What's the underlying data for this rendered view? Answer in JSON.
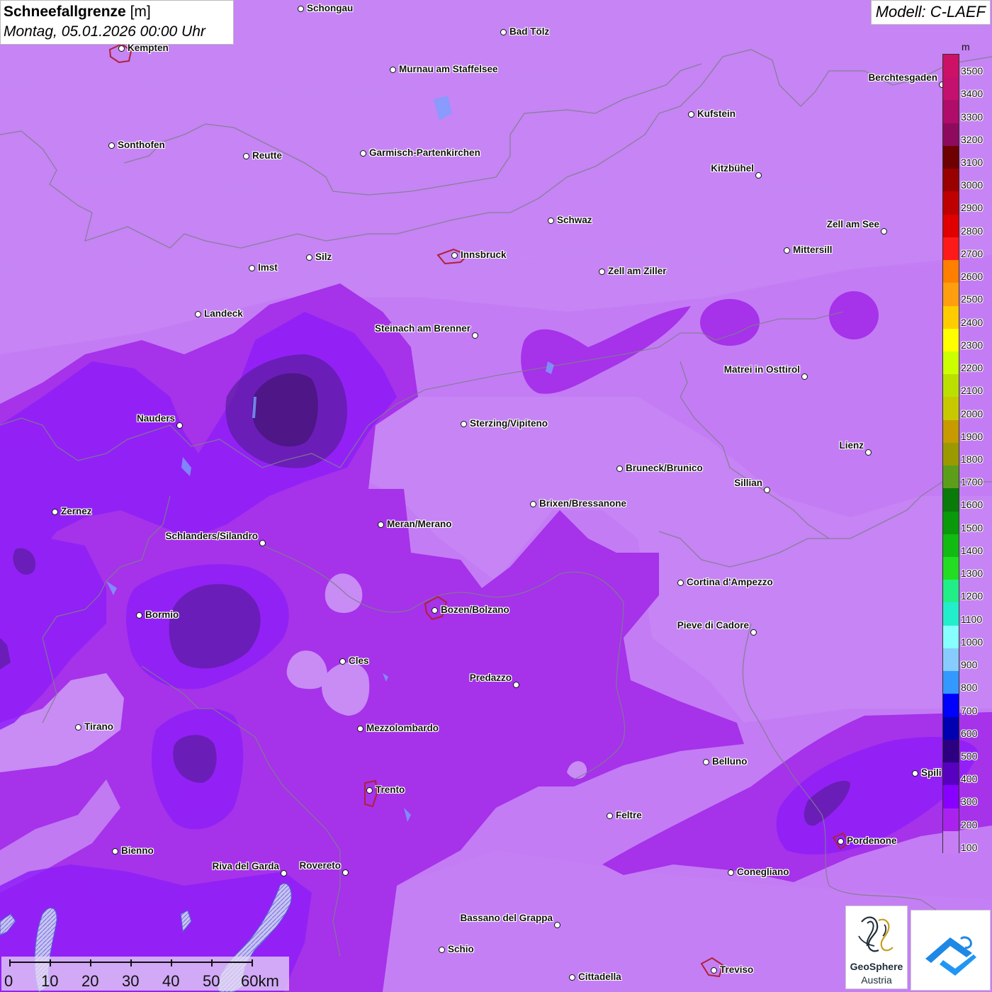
{
  "header": {
    "title_bold": "Schneefallgrenze",
    "title_unit": " [m]",
    "datetime": "Montag, 05.01.2026 00:00 Uhr",
    "model": "Modell: C-LAEF"
  },
  "legend": {
    "unit": "m",
    "entries": [
      {
        "label": "3500",
        "color": "#cc1166"
      },
      {
        "label": "3400",
        "color": "#c4106e"
      },
      {
        "label": "3300",
        "color": "#b00c6a"
      },
      {
        "label": "3200",
        "color": "#8e0a5e"
      },
      {
        "label": "3100",
        "color": "#6e0000"
      },
      {
        "label": "3000",
        "color": "#990000"
      },
      {
        "label": "2900",
        "color": "#bf0000"
      },
      {
        "label": "2800",
        "color": "#e00000"
      },
      {
        "label": "2700",
        "color": "#ff1a1a"
      },
      {
        "label": "2600",
        "color": "#ff7f00"
      },
      {
        "label": "2500",
        "color": "#ff9f10"
      },
      {
        "label": "2400",
        "color": "#ffcc00"
      },
      {
        "label": "2300",
        "color": "#ffff00"
      },
      {
        "label": "2200",
        "color": "#ccff00"
      },
      {
        "label": "2100",
        "color": "#bbe000"
      },
      {
        "label": "2000",
        "color": "#c8c800"
      },
      {
        "label": "1900",
        "color": "#c79a00"
      },
      {
        "label": "1800",
        "color": "#9a9a00"
      },
      {
        "label": "1700",
        "color": "#5c9e1a"
      },
      {
        "label": "1600",
        "color": "#0a7a0a"
      },
      {
        "label": "1500",
        "color": "#0a990a"
      },
      {
        "label": "1400",
        "color": "#11bb11"
      },
      {
        "label": "1300",
        "color": "#22dd22"
      },
      {
        "label": "1200",
        "color": "#22ee88"
      },
      {
        "label": "1100",
        "color": "#22eecc"
      },
      {
        "label": "1000",
        "color": "#88ffff"
      },
      {
        "label": "900",
        "color": "#88ccff"
      },
      {
        "label": "800",
        "color": "#3399ff"
      },
      {
        "label": "700",
        "color": "#0000ff"
      },
      {
        "label": "600",
        "color": "#0000b0"
      },
      {
        "label": "500",
        "color": "#2c0080"
      },
      {
        "label": "400",
        "color": "#5800c0"
      },
      {
        "label": "300",
        "color": "#8800ff"
      },
      {
        "label": "200",
        "color": "#aa22ee"
      },
      {
        "label": "100",
        "color": "#c77ef5"
      }
    ]
  },
  "cities": [
    {
      "name": "Schongau"
    },
    {
      "name": "Bad Tölz"
    },
    {
      "name": "Kempten"
    },
    {
      "name": "Murnau am Staffelsee"
    },
    {
      "name": "Kufstein"
    },
    {
      "name": "Berchtesgaden"
    },
    {
      "name": "Sonthofen"
    },
    {
      "name": "Reutte"
    },
    {
      "name": "Garmisch-Partenkirchen"
    },
    {
      "name": "Kitzbühel"
    },
    {
      "name": "Schwaz"
    },
    {
      "name": "Zell am See"
    },
    {
      "name": "Innsbruck"
    },
    {
      "name": "Imst"
    },
    {
      "name": "Silz"
    },
    {
      "name": "Mittersill"
    },
    {
      "name": "Zell am Ziller"
    },
    {
      "name": "Landeck"
    },
    {
      "name": "Steinach am Brenner"
    },
    {
      "name": "Matrei in Osttirol"
    },
    {
      "name": "Nauders"
    },
    {
      "name": "Sterzing/Vipiteno"
    },
    {
      "name": "Lienz"
    },
    {
      "name": "Bruneck/Brunico"
    },
    {
      "name": "Sillian"
    },
    {
      "name": "Zernez"
    },
    {
      "name": "Brixen/Bressanone"
    },
    {
      "name": "Meran/Merano"
    },
    {
      "name": "Schlanders/Silandro"
    },
    {
      "name": "Cortina d'Ampezzo"
    },
    {
      "name": "Bozen/Bolzano"
    },
    {
      "name": "Bormio"
    },
    {
      "name": "Pieve di Cadore"
    },
    {
      "name": "Cles"
    },
    {
      "name": "Predazzo"
    },
    {
      "name": "Tirano"
    },
    {
      "name": "Mezzolombardo"
    },
    {
      "name": "Belluno"
    },
    {
      "name": "Spili"
    },
    {
      "name": "Trento"
    },
    {
      "name": "Feltre"
    },
    {
      "name": "Pordenone"
    },
    {
      "name": "Bienno"
    },
    {
      "name": "Riva del Garda"
    },
    {
      "name": "Rovereto"
    },
    {
      "name": "Conegliano"
    },
    {
      "name": "Bassano del Grappa"
    },
    {
      "name": "Schio"
    },
    {
      "name": "Treviso"
    },
    {
      "name": "Cittadella"
    }
  ],
  "scale_bar": {
    "labels": [
      "0",
      "10",
      "20",
      "30",
      "40",
      "50",
      "60km"
    ]
  },
  "logos": {
    "geosphere_line1": "GeoSphere",
    "geosphere_line2": "Austria"
  }
}
